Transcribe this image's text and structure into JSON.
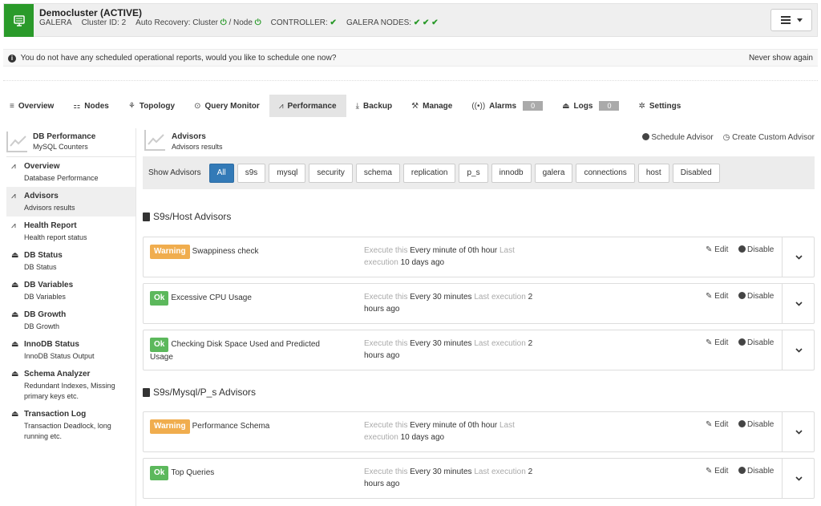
{
  "header": {
    "title": "Democluster (ACTIVE)",
    "type": "GALERA",
    "cluster_id": "Cluster ID: 2",
    "auto_recovery": "Auto Recovery: Cluster",
    "node_label": "/ Node",
    "controller": "CONTROLLER:",
    "galera_nodes": "GALERA NODES:",
    "ok_mark": "✔",
    "power_mark": "⏻"
  },
  "notice": {
    "text": "You do not have any scheduled operational reports, would you like to schedule one now?",
    "never_show": "Never show again"
  },
  "tabs": [
    {
      "label": "Overview",
      "icon": "≡"
    },
    {
      "label": "Nodes",
      "icon": "⚏"
    },
    {
      "label": "Topology",
      "icon": "⚘"
    },
    {
      "label": "Query Monitor",
      "icon": "⊙"
    },
    {
      "label": "Performance",
      "icon": "⩘"
    },
    {
      "label": "Backup",
      "icon": "⤓"
    },
    {
      "label": "Manage",
      "icon": "⚒"
    },
    {
      "label": "Alarms",
      "icon": "((•))",
      "badge": "0"
    },
    {
      "label": "Logs",
      "icon": "⏏",
      "badge": "0"
    },
    {
      "label": "Settings",
      "icon": "✲"
    }
  ],
  "sidebar": {
    "title": "DB Performance",
    "subtitle": "MySQL Counters",
    "items": [
      {
        "label": "Overview",
        "desc": "Database Performance"
      },
      {
        "label": "Advisors",
        "desc": "Advisors results"
      },
      {
        "label": "Health Report",
        "desc": "Health report status"
      },
      {
        "label": "DB Status",
        "desc": "DB Status"
      },
      {
        "label": "DB Variables",
        "desc": "DB Variables"
      },
      {
        "label": "DB Growth",
        "desc": "DB Growth"
      },
      {
        "label": "InnoDB Status",
        "desc": "InnoDB Status Output"
      },
      {
        "label": "Schema Analyzer",
        "desc": "Redundant Indexes, Missing primary keys etc."
      },
      {
        "label": "Transaction Log",
        "desc": "Transaction Deadlock, long running etc."
      }
    ]
  },
  "main": {
    "title": "Advisors",
    "subtitle": "Advisors results",
    "schedule_advisor": "Schedule Advisor",
    "create_custom": "Create Custom Advisor",
    "show_advisors": "Show Advisors",
    "filters": [
      "All",
      "s9s",
      "mysql",
      "security",
      "schema",
      "replication",
      "p_s",
      "innodb",
      "galera",
      "connections",
      "host",
      "Disabled"
    ],
    "sections": [
      {
        "title": "S9s/Host Advisors"
      },
      {
        "title": "S9s/Mysql/P_s Advisors"
      }
    ],
    "execute_label": "Execute this",
    "last_exec_label": "Last execution",
    "edit_label": "Edit",
    "disable_label": "Disable",
    "advisors": [
      {
        "status": "Warning",
        "name": "Swappiness check",
        "schedule": "Every minute of 0th hour",
        "last": "10 days ago"
      },
      {
        "status": "Ok",
        "name": "Excessive CPU Usage",
        "schedule": "Every 30 minutes",
        "last": "2 hours ago"
      },
      {
        "status": "Ok",
        "name": "Checking Disk Space Used and Predicted Usage",
        "schedule": "Every 30 minutes",
        "last": "2 hours ago"
      },
      {
        "status": "Warning",
        "name": "Performance Schema",
        "schedule": "Every minute of 0th hour",
        "last": "10 days ago"
      },
      {
        "status": "Ok",
        "name": "Top Queries",
        "schedule": "Every 30 minutes",
        "last": "2 hours ago"
      }
    ]
  }
}
